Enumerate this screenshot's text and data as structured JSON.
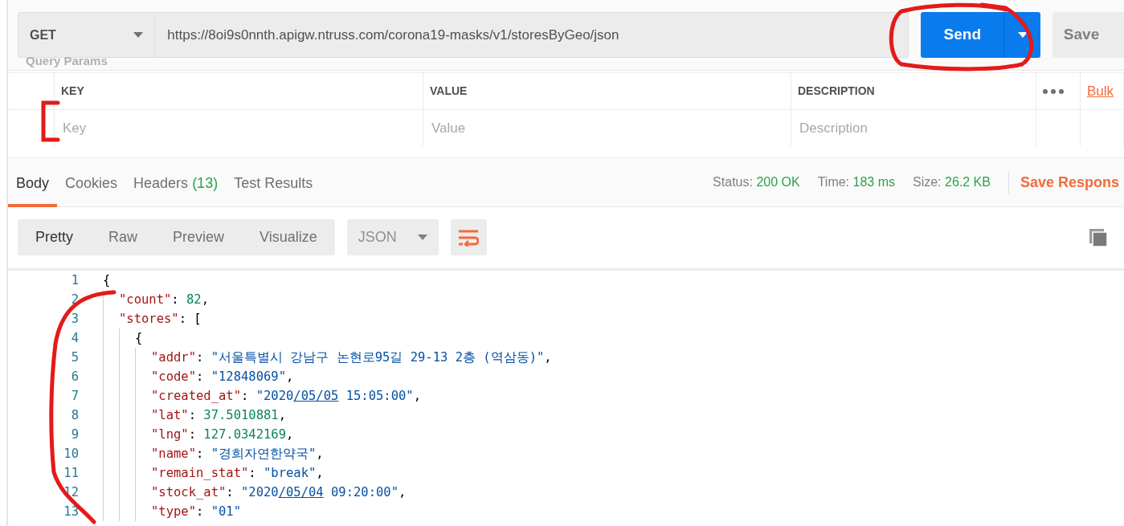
{
  "request": {
    "method": "GET",
    "url": "https://8oi9s0nnth.apigw.ntruss.com/corona19-masks/v1/storesByGeo/json",
    "send_label": "Send",
    "save_label": "Save"
  },
  "params": {
    "title": "Query Params",
    "columns": [
      "KEY",
      "VALUE",
      "DESCRIPTION"
    ],
    "bulk_label": "Bulk",
    "placeholders": [
      "Key",
      "Value",
      "Description"
    ]
  },
  "response_tabs": [
    {
      "label": "Body",
      "selected": true
    },
    {
      "label": "Cookies",
      "selected": false
    },
    {
      "label": "Headers",
      "count": "(13)",
      "selected": false
    },
    {
      "label": "Test Results",
      "selected": false
    }
  ],
  "status": [
    {
      "label": "Status:",
      "value": "200 OK"
    },
    {
      "label": "Time:",
      "value": "183 ms"
    },
    {
      "label": "Size:",
      "value": "26.2 KB"
    }
  ],
  "save_response": "Save Respons",
  "view_modes": [
    {
      "label": "Pretty",
      "selected": true
    },
    {
      "label": "Raw",
      "selected": false
    },
    {
      "label": "Preview",
      "selected": false
    },
    {
      "label": "Visualize",
      "selected": false
    }
  ],
  "format": "JSON",
  "code": [
    {
      "number": "1",
      "tokens": [
        {
          "kind": "punct",
          "text": "{"
        }
      ],
      "children": [
        {
          "number": "2",
          "tokens": [
            {
              "kind": "key",
              "text": "\"count\""
            },
            {
              "kind": "punct",
              "text": ": "
            },
            {
              "kind": "number",
              "text": "82"
            },
            {
              "kind": "punct",
              "text": ","
            }
          ]
        },
        {
          "number": "3",
          "tokens": [
            {
              "kind": "key",
              "text": "\"stores\""
            },
            {
              "kind": "punct",
              "text": ": ["
            }
          ],
          "children": [
            {
              "number": "4",
              "tokens": [
                {
                  "kind": "punct",
                  "text": "{"
                }
              ],
              "children": [
                {
                  "number": "5",
                  "tokens": [
                    {
                      "kind": "key",
                      "text": "\"addr\""
                    },
                    {
                      "kind": "punct",
                      "text": ": "
                    },
                    {
                      "kind": "string",
                      "text": "\"서울특별시 강남구 논현로95길 29-13 2층 (역삼동)\""
                    },
                    {
                      "kind": "punct",
                      "text": ","
                    }
                  ]
                },
                {
                  "number": "6",
                  "tokens": [
                    {
                      "kind": "key",
                      "text": "\"code\""
                    },
                    {
                      "kind": "punct",
                      "text": ": "
                    },
                    {
                      "kind": "string",
                      "text": "\"12848069\""
                    },
                    {
                      "kind": "punct",
                      "text": ","
                    }
                  ]
                },
                {
                  "number": "7",
                  "tokens": [
                    {
                      "kind": "key",
                      "text": "\"created_at\""
                    },
                    {
                      "kind": "punct",
                      "text": ": "
                    },
                    {
                      "kind": "string",
                      "text": "\"2020"
                    },
                    {
                      "kind": "link",
                      "text": "/05/05"
                    },
                    {
                      "kind": "string",
                      "text": " 15:05:00\""
                    },
                    {
                      "kind": "punct",
                      "text": ","
                    }
                  ]
                },
                {
                  "number": "8",
                  "tokens": [
                    {
                      "kind": "key",
                      "text": "\"lat\""
                    },
                    {
                      "kind": "punct",
                      "text": ": "
                    },
                    {
                      "kind": "number",
                      "text": "37.5010881"
                    },
                    {
                      "kind": "punct",
                      "text": ","
                    }
                  ]
                },
                {
                  "number": "9",
                  "tokens": [
                    {
                      "kind": "key",
                      "text": "\"lng\""
                    },
                    {
                      "kind": "punct",
                      "text": ": "
                    },
                    {
                      "kind": "number",
                      "text": "127.0342169"
                    },
                    {
                      "kind": "punct",
                      "text": ","
                    }
                  ]
                },
                {
                  "number": "10",
                  "tokens": [
                    {
                      "kind": "key",
                      "text": "\"name\""
                    },
                    {
                      "kind": "punct",
                      "text": ": "
                    },
                    {
                      "kind": "string",
                      "text": "\"경희자연한약국\""
                    },
                    {
                      "kind": "punct",
                      "text": ","
                    }
                  ]
                },
                {
                  "number": "11",
                  "tokens": [
                    {
                      "kind": "key",
                      "text": "\"remain_stat\""
                    },
                    {
                      "kind": "punct",
                      "text": ": "
                    },
                    {
                      "kind": "string",
                      "text": "\"break\""
                    },
                    {
                      "kind": "punct",
                      "text": ","
                    }
                  ]
                },
                {
                  "number": "12",
                  "tokens": [
                    {
                      "kind": "key",
                      "text": "\"stock_at\""
                    },
                    {
                      "kind": "punct",
                      "text": ": "
                    },
                    {
                      "kind": "string",
                      "text": "\"2020"
                    },
                    {
                      "kind": "link",
                      "text": "/05/04"
                    },
                    {
                      "kind": "string",
                      "text": " 09:20:00\""
                    },
                    {
                      "kind": "punct",
                      "text": ","
                    }
                  ]
                },
                {
                  "number": "13",
                  "tokens": [
                    {
                      "kind": "key",
                      "text": "\"type\""
                    },
                    {
                      "kind": "punct",
                      "text": ": "
                    },
                    {
                      "kind": "string",
                      "text": "\"01\""
                    }
                  ]
                }
              ]
            }
          ]
        }
      ]
    }
  ],
  "annotations": [
    {
      "kind": "circle"
    },
    {
      "kind": "bracket"
    },
    {
      "kind": "arc"
    }
  ]
}
